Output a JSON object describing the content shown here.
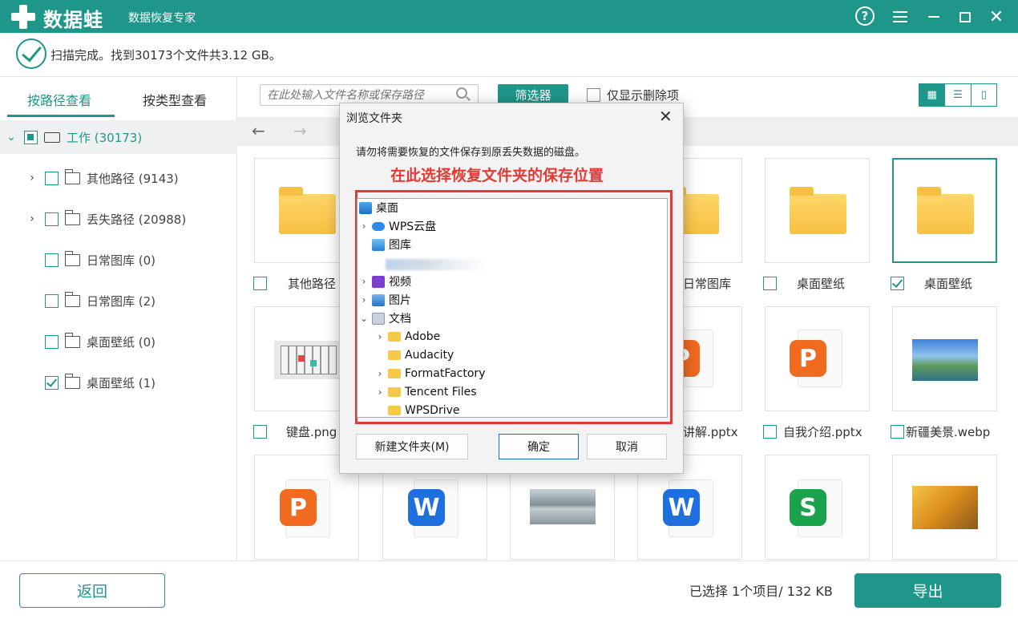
{
  "app": {
    "brand": "数据蛙",
    "subtitle": "数据恢复专家",
    "help_glyph": "?",
    "close_glyph": "✕"
  },
  "status": {
    "message": "扫描完成。找到30173个文件共3.12 GB。"
  },
  "sidebar": {
    "tabs": [
      "按路径查看",
      "按类型查看"
    ],
    "active_tab": 0,
    "root": {
      "label": "工作 (30173)",
      "state": "partial"
    },
    "items": [
      {
        "label": "其他路径 (9143)",
        "expandable": true,
        "checked": false
      },
      {
        "label": "丢失路径 (20988)",
        "expandable": true,
        "checked": false
      },
      {
        "label": "日常图库 (0)",
        "expandable": false,
        "checked": false
      },
      {
        "label": "日常图库 (2)",
        "expandable": false,
        "checked": false
      },
      {
        "label": "桌面壁纸 (0)",
        "expandable": false,
        "checked": false
      },
      {
        "label": "桌面壁纸 (1)",
        "expandable": false,
        "checked": true
      }
    ]
  },
  "toolbar": {
    "search_placeholder": "在此处输入文件名称或保存路径",
    "filter_label": "筛选器",
    "deleted_only_label": "仅显示删除项"
  },
  "grid": {
    "labels": {
      "r1c1": "其他路径",
      "r1c4": "日常图库",
      "r1c5": "桌面壁纸",
      "r1c6": "桌面壁纸",
      "r2c1": "键盘.png",
      "r2c4": "讲解.pptx",
      "r2c5": "自我介绍.pptx",
      "r2c6": "新疆美景.webp"
    },
    "checked_label": "r1c6",
    "badges": {
      "p": "P",
      "w": "W",
      "s": "S"
    },
    "colors": {
      "ppt": "#f06a1f",
      "word": "#1e6fe0",
      "sheet": "#1aa34a"
    }
  },
  "footer": {
    "back_label": "返回",
    "selection_info": "已选择 1个项目/ 132 KB",
    "export_label": "导出"
  },
  "dialog": {
    "title": "浏览文件夹",
    "close_glyph": "✕",
    "note": "请勿将需要恢复的文件保存到原丢失数据的磁盘。",
    "hint": "在此选择恢复文件夹的保存位置",
    "tree": [
      {
        "label": "桌面",
        "icon": "desktop-icon",
        "indent": 0,
        "chevron": ""
      },
      {
        "label": "WPS云盘",
        "icon": "cloud-icon",
        "indent": 1,
        "chevron": "›"
      },
      {
        "label": "图库",
        "icon": "gallery-icon",
        "indent": 1,
        "chevron": ""
      },
      {
        "label": "视频",
        "icon": "video-icon",
        "indent": 1,
        "chevron": "›"
      },
      {
        "label": "图片",
        "icon": "pictures-icon",
        "indent": 1,
        "chevron": "›"
      },
      {
        "label": "文档",
        "icon": "documents-icon",
        "indent": 1,
        "chevron": "⌄"
      },
      {
        "label": "Adobe",
        "icon": "folder-icon",
        "indent": 2,
        "chevron": "›"
      },
      {
        "label": "Audacity",
        "icon": "folder-icon",
        "indent": 2,
        "chevron": ""
      },
      {
        "label": "FormatFactory",
        "icon": "folder-icon",
        "indent": 2,
        "chevron": "›"
      },
      {
        "label": "Tencent Files",
        "icon": "folder-icon",
        "indent": 2,
        "chevron": "›"
      },
      {
        "label": "WPSDrive",
        "icon": "folder-icon",
        "indent": 2,
        "chevron": ""
      }
    ],
    "new_folder_label": "新建文件夹(M)",
    "ok_label": "确定",
    "cancel_label": "取消"
  },
  "colors": {
    "accent": "#1f968a",
    "hint_red": "#e53935"
  }
}
